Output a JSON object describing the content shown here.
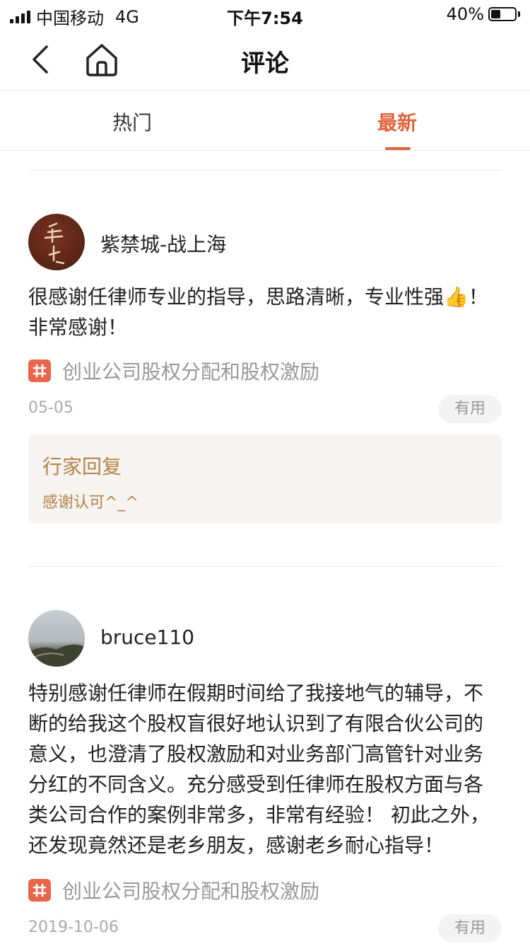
{
  "status_bar": {
    "carrier": "中国移动",
    "network": "4G",
    "time": "下午7:54",
    "battery_percent": "40%",
    "battery_level": 0.4
  },
  "nav": {
    "title": "评论",
    "back_icon": "chevron-left-icon",
    "home_icon": "home-icon"
  },
  "tabs": [
    {
      "label": "热门",
      "active": false
    },
    {
      "label": "最新",
      "active": true
    }
  ],
  "colors": {
    "accent": "#e0643f",
    "reply_text": "#b4834b",
    "reply_bg": "#f6f4f0",
    "topic_icon_bg": "#e8664a"
  },
  "comments": [
    {
      "username": "紫禁城-战上海",
      "text": "很感谢任律师专业的指导，思路清晰，专业性强👍！非常感谢！",
      "topic": "创业公司股权分配和股权激励",
      "date": "05-05",
      "useful_label": "有用",
      "reply": {
        "title": "行家回复",
        "text": "感谢认可^_^"
      }
    },
    {
      "username": "bruce110",
      "text": "特别感谢任律师在假期时间给了我接地气的辅导，不断的给我这个股权盲很好地认识到了有限合伙公司的意义，也澄清了股权激励和对业务部门高管针对业务分红的不同含义。充分感受到任律师在股权方面与各类公司合作的案例非常多，非常有经验！ 初此之外，还发现竟然还是老乡朋友，感谢老乡耐心指导！",
      "topic": "创业公司股权分配和股权激励",
      "date": "2019-10-06",
      "useful_label": "有用"
    }
  ]
}
